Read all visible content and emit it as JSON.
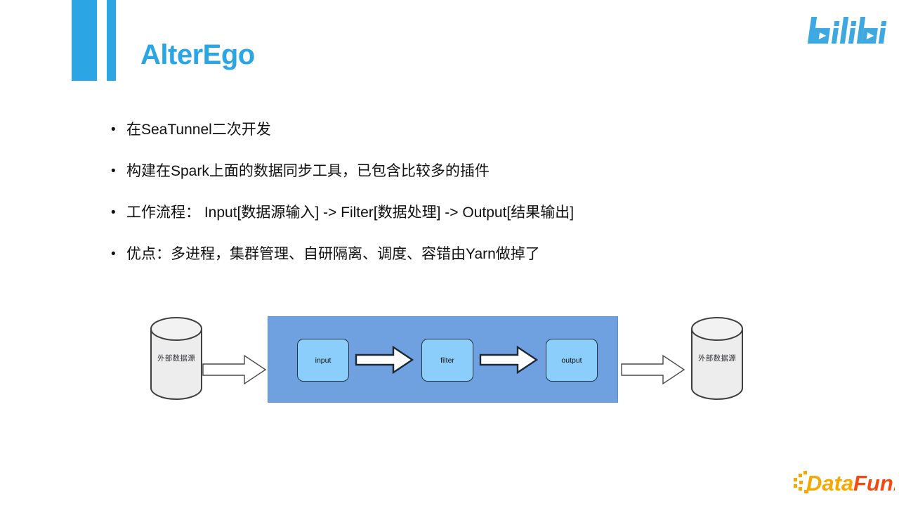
{
  "slide": {
    "title": "AlterEgo",
    "accent_color": "#2ba6e4",
    "background_color": "#ffffff"
  },
  "brand": {
    "top_right_logo": "bilibili-logo",
    "top_right_logo_text": "bilibili",
    "bottom_right_logo": "datafun-logo",
    "bottom_right_logo_text": "DataFun."
  },
  "bullets": [
    {
      "marker": "•",
      "text": "在SeaTunnel二次开发"
    },
    {
      "marker": "•",
      "text": "构建在Spark上面的数据同步工具，已包含比较多的插件"
    },
    {
      "marker": "•",
      "text": "工作流程： Input[数据源输入] -> Filter[数据处理] -> Output[结果输出]"
    },
    {
      "marker": "•",
      "text": "优点：多进程，集群管理、自研隔离、调度、容错由Yarn做掉了"
    }
  ],
  "diagram": {
    "source_cylinder": {
      "label": "外部数据源",
      "icon": "database-cylinder-icon"
    },
    "sink_cylinder": {
      "label": "外部数据源",
      "icon": "database-cylinder-icon"
    },
    "pipeline_color": "#6fa0e0",
    "stage_color": "#8bcdfb",
    "stages": [
      {
        "label": "input"
      },
      {
        "label": "filter"
      },
      {
        "label": "output"
      }
    ],
    "arrows": [
      {
        "name": "arrow-source-to-pipeline"
      },
      {
        "name": "arrow-input-to-filter"
      },
      {
        "name": "arrow-filter-to-output"
      },
      {
        "name": "arrow-pipeline-to-sink"
      }
    ]
  }
}
